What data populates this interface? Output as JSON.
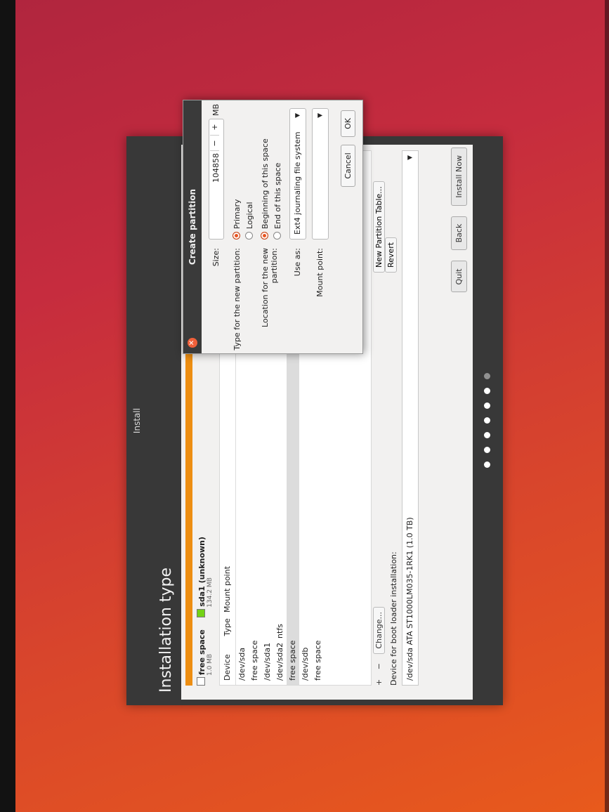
{
  "window": {
    "title": "Install"
  },
  "page": {
    "title": "Installation type"
  },
  "legend": [
    {
      "name": "free space",
      "size": "1.0 MB",
      "color": "#ffffff"
    },
    {
      "name": "sda1 (unknown)",
      "size": "134.2 MB",
      "color": "#73d216"
    }
  ],
  "table": {
    "headers": {
      "device": "Device",
      "type": "Type",
      "mount": "Mount point"
    },
    "rows": [
      {
        "device": "/dev/sda",
        "type": "",
        "mount": ""
      },
      {
        "device": "free space",
        "type": "",
        "mount": ""
      },
      {
        "device": "/dev/sda1",
        "type": "",
        "mount": ""
      },
      {
        "device": "/dev/sda2",
        "type": "ntfs",
        "mount": ""
      },
      {
        "device": "free space",
        "type": "",
        "mount": ""
      },
      {
        "device": "/dev/sdb",
        "type": "",
        "mount": ""
      },
      {
        "device": "free space",
        "type": "",
        "mount": ""
      }
    ]
  },
  "tools": {
    "add": "+",
    "remove": "−",
    "change": "Change..."
  },
  "new_partition_table": "New Partition Table...",
  "revert": "Revert",
  "boot": {
    "label": "Device for boot loader installation:",
    "value": "/dev/sda   ATA ST1000LM035-1RK1 (1.0 TB)"
  },
  "nav": {
    "quit": "Quit",
    "back": "Back",
    "install": "Install Now"
  },
  "dialog": {
    "title": "Create partition",
    "size_label": "Size:",
    "size_value": "104858",
    "minus": "−",
    "plus": "+",
    "unit": "MB",
    "type_label": "Type for the new partition:",
    "type_primary": "Primary",
    "type_logical": "Logical",
    "location_label": "Location for the new partition:",
    "loc_begin": "Beginning of this space",
    "loc_end": "End of this space",
    "use_as_label": "Use as:",
    "use_as_value": "Ext4 journaling file system",
    "mount_label": "Mount point:",
    "mount_value": "",
    "cancel": "Cancel",
    "ok": "OK"
  },
  "progress_dots": {
    "total": 7,
    "current": 6
  },
  "colors": {
    "accent": "#e95420",
    "usage_bar": "#ed8e12"
  }
}
